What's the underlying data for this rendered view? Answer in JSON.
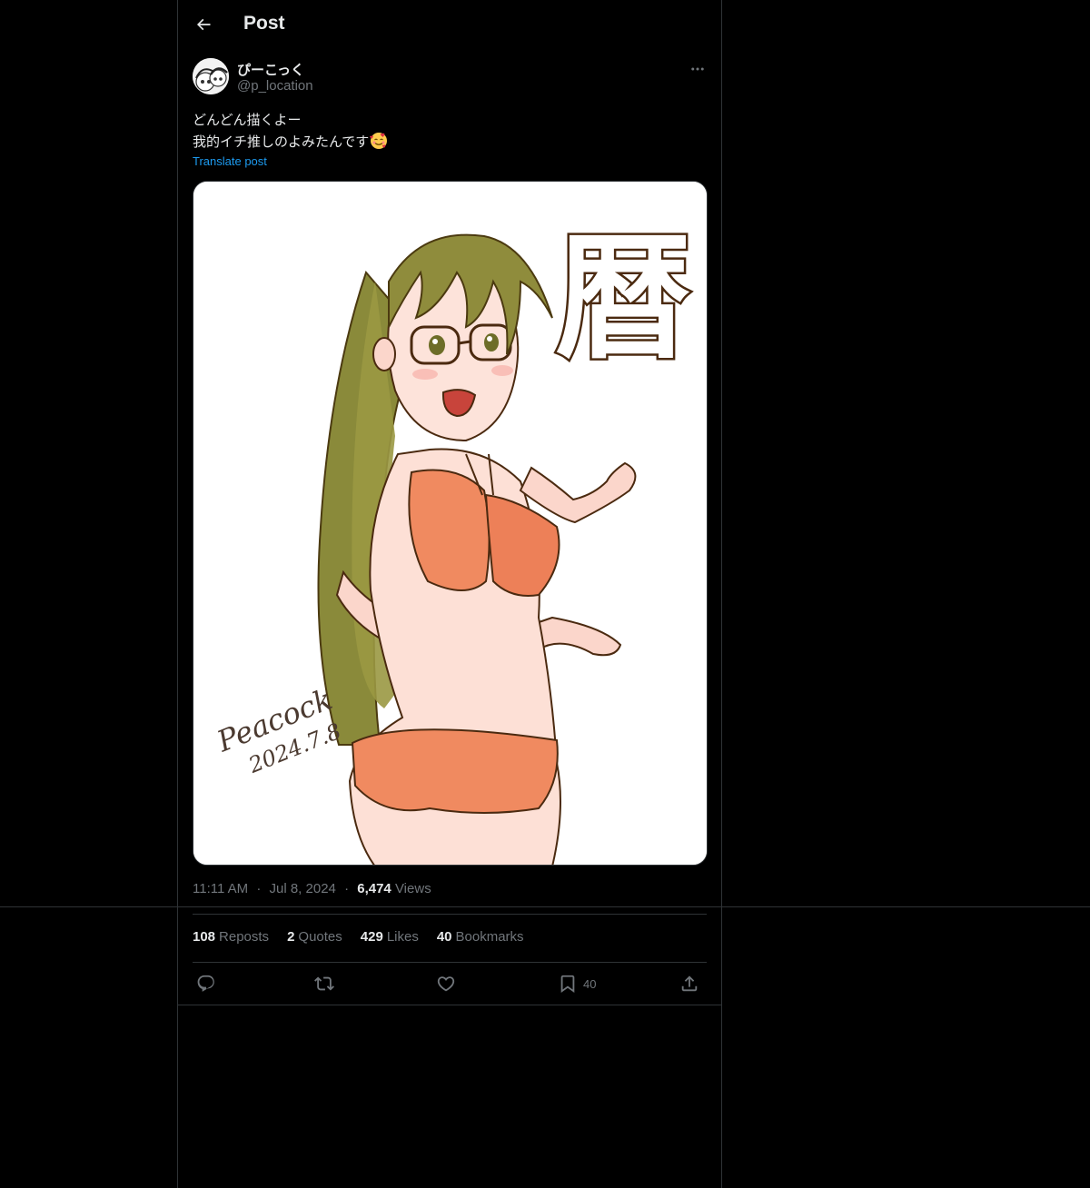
{
  "header": {
    "title": "Post"
  },
  "author": {
    "display_name": "ぴーこっく",
    "handle": "@p_location"
  },
  "post": {
    "lines": [
      "どんどん描くよー",
      "我的イチ推しのよみたんです"
    ],
    "translate_label": "Translate post",
    "image": {
      "kanji": "暦",
      "signature_line1": "Peacock",
      "signature_line2": "2024.7.8"
    }
  },
  "meta": {
    "time": "11:11 AM",
    "dot": "·",
    "date": "Jul 8, 2024",
    "views_count": "6,474",
    "views_label": "Views"
  },
  "stats": {
    "reposts_count": "108",
    "reposts_label": "Reposts",
    "quotes_count": "2",
    "quotes_label": "Quotes",
    "likes_count": "429",
    "likes_label": "Likes",
    "bookmarks_count": "40",
    "bookmarks_label": "Bookmarks"
  },
  "actions": {
    "bookmark_count": "40"
  },
  "colors": {
    "background": "#000000",
    "text": "#e7e9ea",
    "muted": "#71767b",
    "link": "#1d9bf0",
    "divider": "#2f3336"
  },
  "icons": [
    "back-arrow-icon",
    "more-icon",
    "reply-icon",
    "repost-icon",
    "like-icon",
    "bookmark-icon",
    "share-icon"
  ]
}
